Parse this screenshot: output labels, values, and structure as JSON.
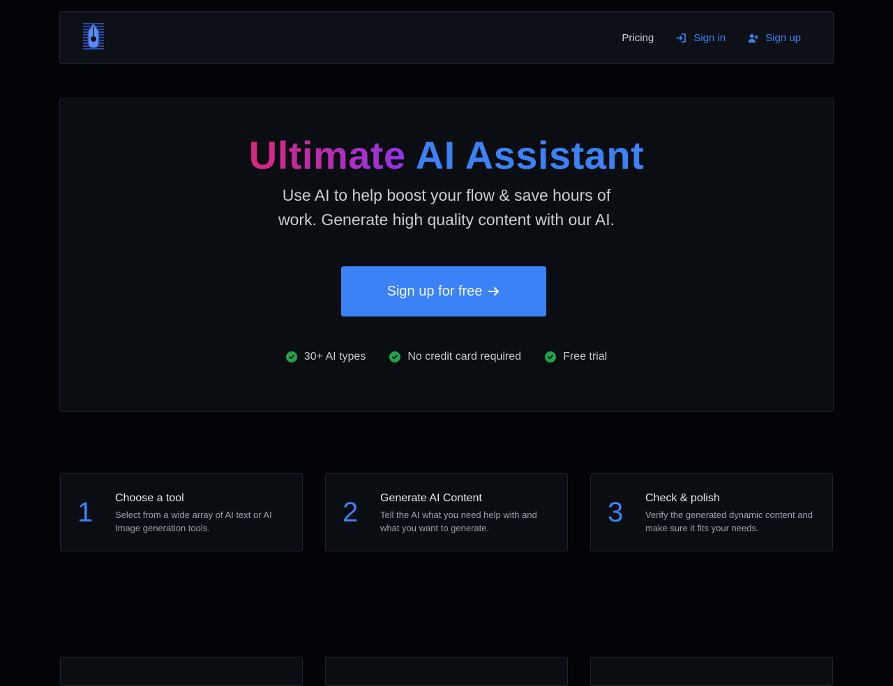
{
  "nav": {
    "pricing": "Pricing",
    "sign_in": "Sign in",
    "sign_up": "Sign up"
  },
  "hero": {
    "title_part1": "Ultimate",
    "title_part2": "AI Assistant",
    "subtitle": "Use AI to help boost your flow & save hours of work. Generate high quality content with our AI.",
    "cta_label": "Sign up for free",
    "features": [
      "30+ AI types",
      "No credit card required",
      "Free trial"
    ]
  },
  "steps": [
    {
      "number": "1",
      "title": "Choose a tool",
      "desc": "Select from a wide array of AI text or AI Image generation tools."
    },
    {
      "number": "2",
      "title": "Generate AI Content",
      "desc": "Tell the AI what you need help with and what you want to generate."
    },
    {
      "number": "3",
      "title": "Check & polish",
      "desc": "Verify the generated dynamic content and make sure it fits your needs."
    }
  ],
  "colors": {
    "accent": "#3b82f6",
    "gradient_start": "#db2777",
    "gradient_end": "#9333ea",
    "check": "#22a34a",
    "background": "#030407"
  }
}
